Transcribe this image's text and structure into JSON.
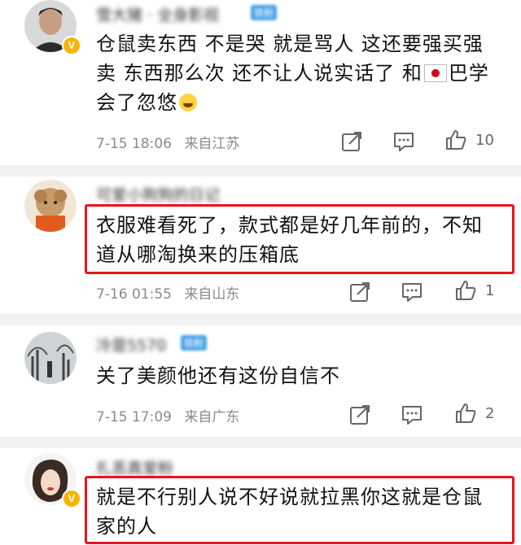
{
  "comments": [
    {
      "username": "雪大猪 · 全身影视",
      "badge": "铁粉",
      "text": "仓鼠卖东西 不是哭 就是骂人 这还要强买强卖 东西那么次 还不让人说实话了 和",
      "text_after_flag": "巴学会了忽悠",
      "time": "7-15 18:06",
      "location": "来自江苏",
      "likes": "10"
    },
    {
      "username": "可爱小狗狗的日记",
      "text": "衣服难看死了，款式都是好几年前的，不知道从哪淘换来的压箱底",
      "time": "7-16 01:55",
      "location": "来自山东",
      "likes": "1"
    },
    {
      "username": "冷是5570",
      "badge": "铁粉",
      "text": "关了美颜他还有这份自信不",
      "time": "7-15 17:09",
      "location": "来自广东",
      "likes": "2"
    },
    {
      "username": "扎丢真爱粉",
      "text": "就是不行别人说不好说就拉黑你这就是仓鼠家的人"
    }
  ],
  "icons": {
    "share": "share-icon",
    "comment": "comment-icon",
    "like": "thumbs-up-icon",
    "verified": "verified-v-icon"
  },
  "colors": {
    "highlight": "#e8141c",
    "meta": "#8a8a8a",
    "verified": "#f7b500"
  }
}
